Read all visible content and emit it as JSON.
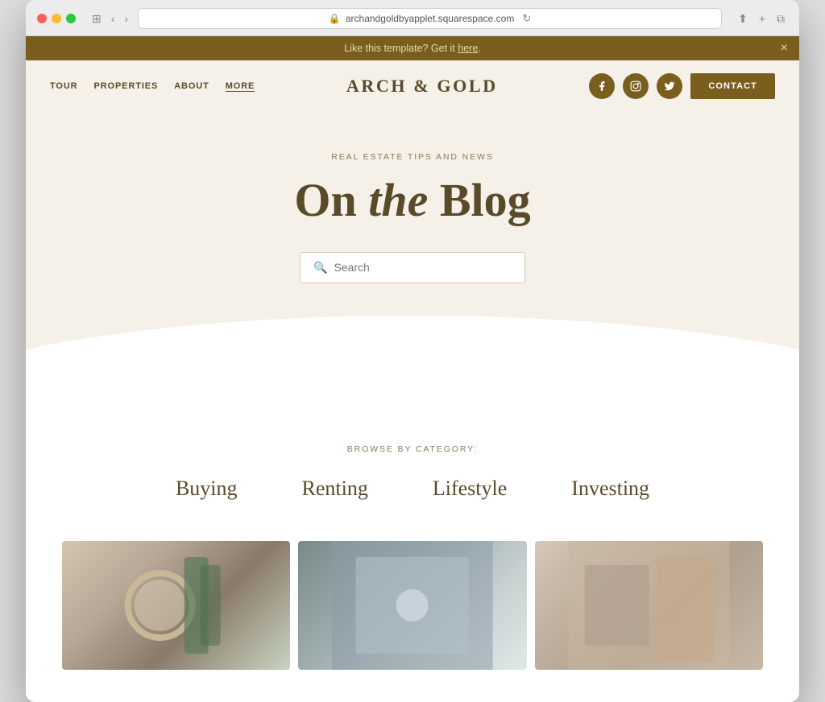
{
  "browser": {
    "url": "archandgoldbyapplet.squarespace.com",
    "nav_back": "‹",
    "nav_forward": "›",
    "nav_sidebar": "⊞",
    "refresh": "↻"
  },
  "announcement": {
    "text": "Like this template? Get it ",
    "link_text": "here",
    "close": "×"
  },
  "nav": {
    "logo": "ARCH & GOLD",
    "items": [
      {
        "label": "TOUR",
        "active": false
      },
      {
        "label": "PROPERTIES",
        "active": false
      },
      {
        "label": "ABOUT",
        "active": false
      },
      {
        "label": "MORE",
        "active": true
      }
    ],
    "contact_label": "CONTACT",
    "social": [
      {
        "name": "facebook",
        "icon": "f"
      },
      {
        "name": "instagram",
        "icon": "📷"
      },
      {
        "name": "twitter",
        "icon": "🐦"
      }
    ]
  },
  "hero": {
    "subtitle": "REAL ESTATE TIPS AND NEWS",
    "title_part1": "On ",
    "title_italic": "the",
    "title_part2": " Blog",
    "search_placeholder": "Search"
  },
  "categories": {
    "label": "BROWSE BY CATEGORY:",
    "items": [
      {
        "label": "Buying"
      },
      {
        "label": "Renting"
      },
      {
        "label": "Lifestyle"
      },
      {
        "label": "Investing"
      }
    ]
  }
}
